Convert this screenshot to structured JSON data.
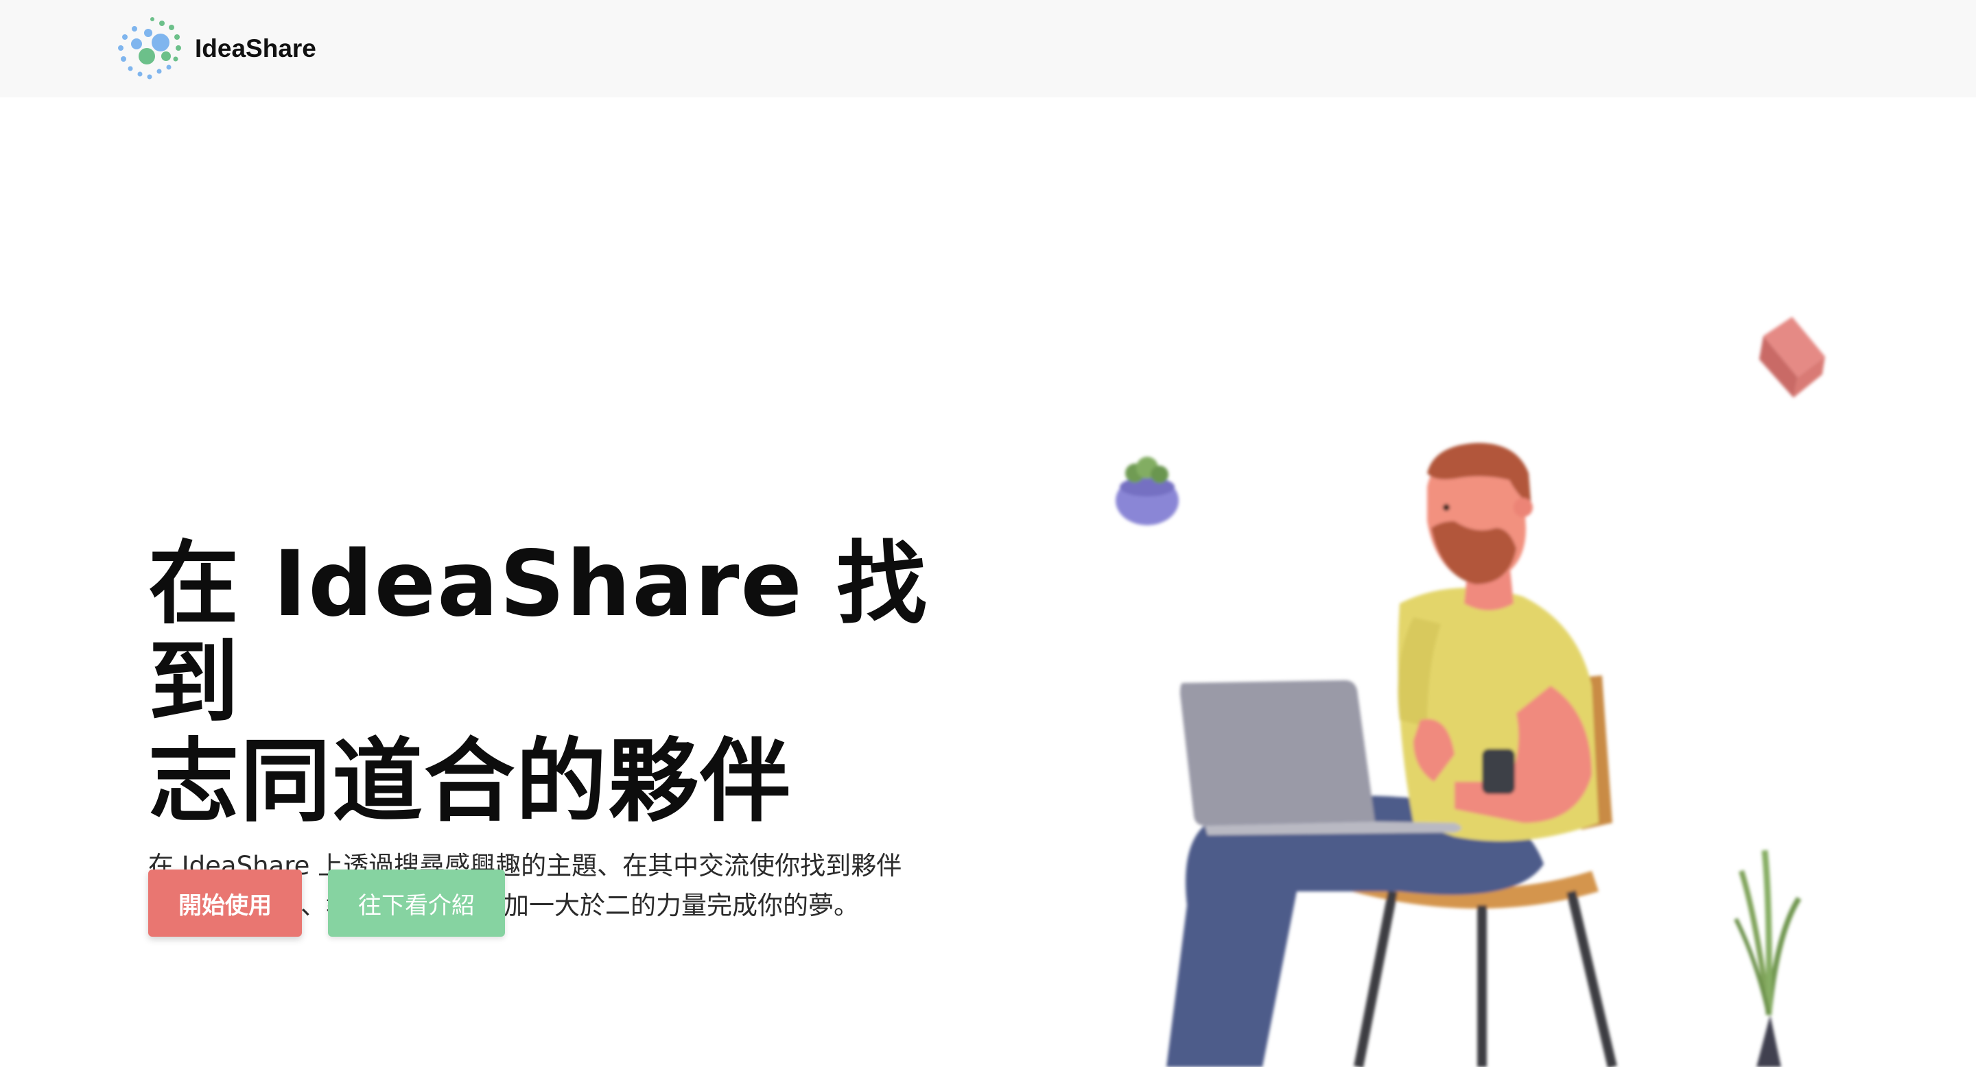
{
  "navbar": {
    "brand_name": "IdeaShare",
    "logo_icon": "dots-logo-icon"
  },
  "hero": {
    "title_line1": "在 IdeaShare 找到",
    "title_line2": "志同道合的夥伴",
    "description_line1": "在 IdeaShare 上透過搜尋感興趣的主題、在其中交流使你找到夥伴",
    "description_line2": "一起參加比賽、執行專案。用一加一大於二的力量完成你的夢。"
  },
  "actions": {
    "start_label": "開始使用",
    "more_label": "往下看介紹"
  },
  "illustration": {
    "subject": "person-with-laptop-illustration"
  },
  "colors": {
    "navbar_bg": "#f8f8f8",
    "start_button": "#e97671",
    "more_button": "#86d3a1",
    "logo_blue": "#7fb5ee",
    "logo_green": "#6cc08a"
  }
}
